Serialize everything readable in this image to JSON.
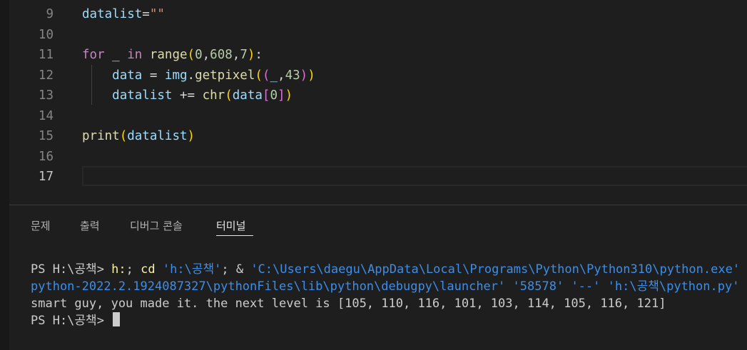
{
  "editor": {
    "lines": [
      {
        "num": "9",
        "tokens": [
          [
            "var",
            "datalist"
          ],
          [
            "op",
            "="
          ],
          [
            "str",
            "\"\""
          ]
        ]
      },
      {
        "num": "10",
        "tokens": []
      },
      {
        "num": "11",
        "tokens": [
          [
            "kw",
            "for"
          ],
          [
            "op",
            " _ "
          ],
          [
            "kw",
            "in"
          ],
          [
            "op",
            " "
          ],
          [
            "fn",
            "range"
          ],
          [
            "p1",
            "("
          ],
          [
            "num",
            "0"
          ],
          [
            "op",
            ","
          ],
          [
            "num",
            "608"
          ],
          [
            "op",
            ","
          ],
          [
            "num",
            "7"
          ],
          [
            "p1",
            ")"
          ],
          [
            "op",
            ":"
          ]
        ]
      },
      {
        "num": "12",
        "tokens": [
          [
            "op",
            "    "
          ],
          [
            "var",
            "data"
          ],
          [
            "op",
            " = "
          ],
          [
            "var",
            "img"
          ],
          [
            "op",
            "."
          ],
          [
            "fn",
            "getpixel"
          ],
          [
            "p1",
            "("
          ],
          [
            "p2",
            "("
          ],
          [
            "var",
            "_"
          ],
          [
            "op",
            ","
          ],
          [
            "num",
            "43"
          ],
          [
            "p2",
            ")"
          ],
          [
            "p1",
            ")"
          ]
        ]
      },
      {
        "num": "13",
        "tokens": [
          [
            "op",
            "    "
          ],
          [
            "var",
            "datalist"
          ],
          [
            "op",
            " += "
          ],
          [
            "fn",
            "chr"
          ],
          [
            "p1",
            "("
          ],
          [
            "var",
            "data"
          ],
          [
            "p2",
            "["
          ],
          [
            "num",
            "0"
          ],
          [
            "p2",
            "]"
          ],
          [
            "p1",
            ")"
          ]
        ]
      },
      {
        "num": "14",
        "tokens": []
      },
      {
        "num": "15",
        "tokens": [
          [
            "fn",
            "print"
          ],
          [
            "p1",
            "("
          ],
          [
            "var",
            "datalist"
          ],
          [
            "p1",
            ")"
          ]
        ]
      },
      {
        "num": "16",
        "tokens": []
      },
      {
        "num": "17",
        "tokens": []
      }
    ],
    "active_line": "17"
  },
  "panel": {
    "tabs": [
      {
        "label": "문제"
      },
      {
        "label": "출력"
      },
      {
        "label": "디버그 콘솔"
      },
      {
        "label": "터미널"
      }
    ],
    "active_tab": "터미널"
  },
  "terminal": {
    "line1": {
      "prompt": "PS H:\\공책> ",
      "cmd1": "h:",
      "sep1": "; ",
      "cmd2": "cd",
      "arg": " ",
      "str1": "'h:\\공책'",
      "sep2": "; ",
      "amp": "& ",
      "str2": "'C:\\Users\\daegu\\AppData\\Local\\Programs\\Python\\Python310\\python.exe'"
    },
    "line2": {
      "str1": "python-2022.2.1924087327\\pythonFiles\\lib\\python\\debugpy\\launcher'",
      "sp1": " ",
      "str2": "'58578'",
      "sp2": " ",
      "str3": "'--'",
      "sp3": " ",
      "str4": "'h:\\공책\\python.py'"
    },
    "line3": "smart guy, you made it. the next level is [105, 110, 116, 101, 103, 114, 105, 116, 121]",
    "line4_prompt": "PS H:\\공책> "
  }
}
